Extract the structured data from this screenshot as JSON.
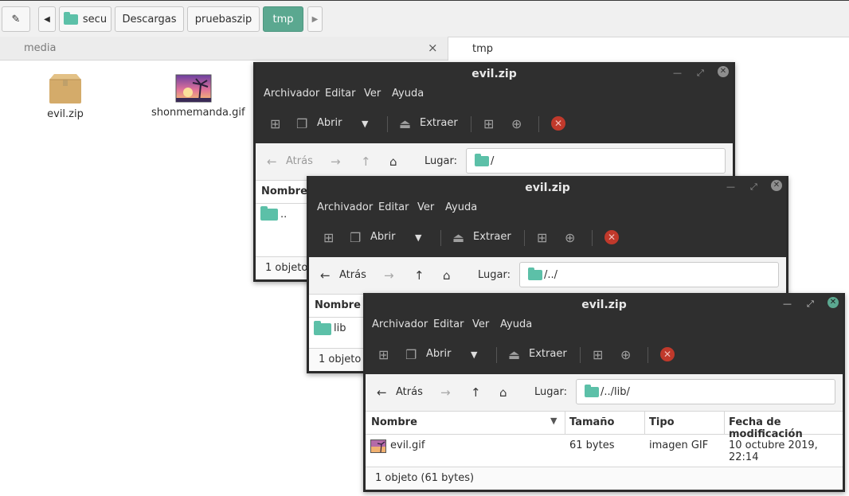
{
  "pathbar": {
    "edit_icon": "pencil-icon",
    "crumbs": [
      "secu",
      "Descargas",
      "pruebaszip",
      "tmp"
    ]
  },
  "tabs": {
    "left": "media",
    "right": "tmp",
    "close": "×"
  },
  "desktop_files": [
    {
      "name": "evil.zip",
      "icon": "package-icon"
    },
    {
      "name": "shonmemanda.gif",
      "icon": "image-icon"
    }
  ],
  "archive": {
    "title": "evil.zip",
    "menu": [
      "Archivador",
      "Editar",
      "Ver",
      "Ayuda"
    ],
    "toolbar": {
      "open": "Abrir",
      "extract": "Extraer"
    },
    "nav": {
      "back": "Atrás",
      "location_label": "Lugar:"
    },
    "columns": [
      "Nombre",
      "Tamaño",
      "Tipo",
      "Fecha de modificación"
    ]
  },
  "windows": [
    {
      "location": "/",
      "row_name": "..",
      "status": "1 objeto"
    },
    {
      "location": "/../",
      "row_name": "lib",
      "status": "1 objeto ("
    },
    {
      "location": "/../lib/",
      "row_name": "evil.gif",
      "row_size": "61 bytes",
      "row_type": "imagen GIF",
      "row_date": "10 octubre 2019, 22:14",
      "status": "1 objeto (61 bytes)"
    }
  ],
  "colors": {
    "accent": "#5ba890",
    "titlebar": "#2f2f2f",
    "stop": "#c0392b"
  }
}
